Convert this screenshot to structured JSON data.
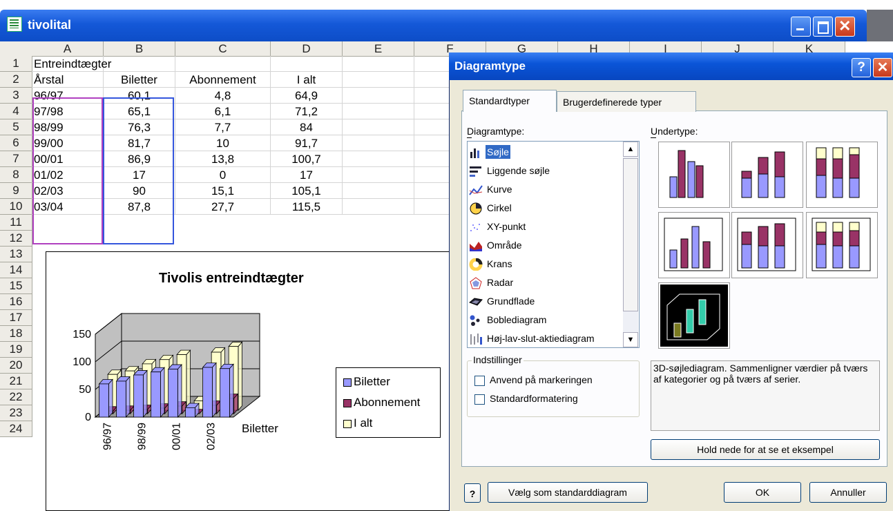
{
  "excel": {
    "window_title": "tivolital",
    "columns": [
      "A",
      "B",
      "C",
      "D",
      "E",
      "F",
      "G",
      "H",
      "I",
      "J",
      "K"
    ],
    "rows": [
      "1",
      "2",
      "3",
      "4",
      "5",
      "6",
      "7",
      "8",
      "9",
      "10",
      "11",
      "12",
      "13",
      "14",
      "15",
      "16",
      "17",
      "18",
      "19",
      "20",
      "21",
      "22",
      "23",
      "24"
    ],
    "data": [
      [
        "Entreindtægter",
        "",
        "",
        ""
      ],
      [
        "Årstal",
        "Biletter",
        "Abonnement",
        "I alt"
      ],
      [
        "96/97",
        "60,1",
        "4,8",
        "64,9"
      ],
      [
        "97/98",
        "65,1",
        "6,1",
        "71,2"
      ],
      [
        "98/99",
        "76,3",
        "7,7",
        "84"
      ],
      [
        "99/00",
        "81,7",
        "10",
        "91,7"
      ],
      [
        "00/01",
        "86,9",
        "13,8",
        "100,7"
      ],
      [
        "01/02",
        "17",
        "0",
        "17"
      ],
      [
        "02/03",
        "90",
        "15,1",
        "105,1"
      ],
      [
        "03/04",
        "87,8",
        "27,7",
        "115,5"
      ]
    ]
  },
  "chart": {
    "title": "Tivolis entreindtægter",
    "y_ticks": [
      "150",
      "100",
      "50",
      "0"
    ],
    "x_ticks": [
      "96/97",
      "98/99",
      "00/01",
      "02/03"
    ],
    "depth_label": "Biletter",
    "legend": [
      "Biletter",
      "Abonnement",
      "I alt"
    ],
    "colors": {
      "Biletter": "#9999ff",
      "Abonnement": "#993366",
      "I alt": "#ffffcc"
    }
  },
  "chart_data": {
    "type": "bar",
    "categories": [
      "96/97",
      "97/98",
      "98/99",
      "99/00",
      "00/01",
      "01/02",
      "02/03",
      "03/04"
    ],
    "series": [
      {
        "name": "Biletter",
        "values": [
          60.1,
          65.1,
          76.3,
          81.7,
          86.9,
          17,
          90,
          87.8
        ]
      },
      {
        "name": "Abonnement",
        "values": [
          4.8,
          6.1,
          7.7,
          10,
          13.8,
          0,
          15.1,
          27.7
        ]
      },
      {
        "name": "I alt",
        "values": [
          64.9,
          71.2,
          84,
          91.7,
          100.7,
          17,
          105.1,
          115.5
        ]
      }
    ],
    "title": "Tivolis entreindtægter",
    "ylim": [
      0,
      150
    ]
  },
  "dialog": {
    "title": "Diagramtype",
    "help": "?",
    "tabs": [
      "Standardtyper",
      "Brugerdefinerede typer"
    ],
    "type_label": "Diagramtype:",
    "subtype_label": "Undertype:",
    "types": [
      {
        "label": "Søjle",
        "icon": "column-chart-icon"
      },
      {
        "label": "Liggende søjle",
        "icon": "bar-chart-icon"
      },
      {
        "label": "Kurve",
        "icon": "line-chart-icon"
      },
      {
        "label": "Cirkel",
        "icon": "pie-chart-icon"
      },
      {
        "label": "XY-punkt",
        "icon": "scatter-chart-icon"
      },
      {
        "label": "Område",
        "icon": "area-chart-icon"
      },
      {
        "label": "Krans",
        "icon": "doughnut-chart-icon"
      },
      {
        "label": "Radar",
        "icon": "radar-chart-icon"
      },
      {
        "label": "Grundflade",
        "icon": "surface-chart-icon"
      },
      {
        "label": "Boblediagram",
        "icon": "bubble-chart-icon"
      },
      {
        "label": "Høj-lav-slut-aktiediagram",
        "icon": "stock-chart-icon"
      }
    ],
    "options_group": "Indstillinger",
    "opt1": "Anvend på markeringen",
    "opt2": "Standardformatering",
    "description": "3D-søjlediagram. Sammenligner værdier på tværs af kategorier og på tværs af serier.",
    "preview_button": "Hold nede for at se et eksempel",
    "default_button": "Vælg som standarddiagram",
    "ok": "OK",
    "cancel": "Annuller"
  }
}
